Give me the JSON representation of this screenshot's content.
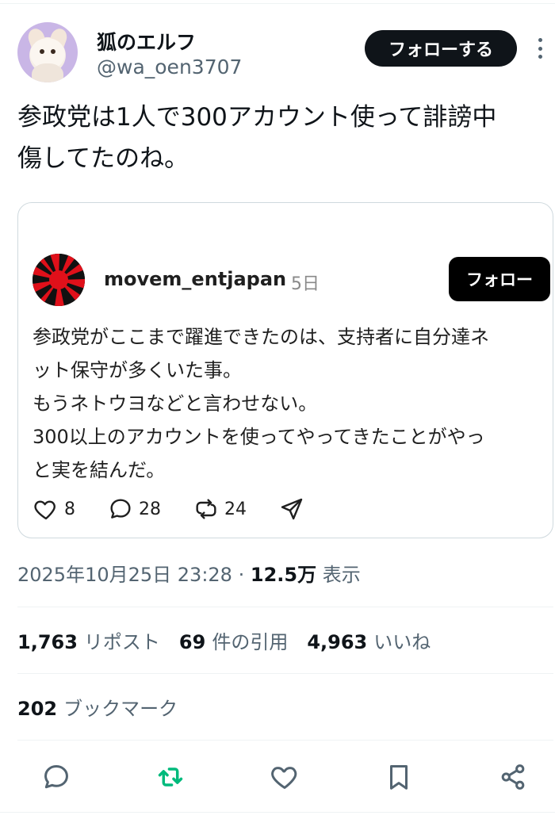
{
  "author": {
    "display_name": "狐のエルフ",
    "handle": "@wa_oen3707",
    "follow_label": "フォローする"
  },
  "tweet": {
    "text_line1": "参政党は1人で300アカウント使って誹謗中",
    "text_line2": "傷してたのね。"
  },
  "quoted_post": {
    "username": "movem_entjapan",
    "time": "5日",
    "follow_label": "フォロー",
    "lines": [
      "参政党がここまで躍進できたのは、支持者に自分達ネ",
      "ット保守が多くいた事。",
      "もうネトウヨなどと言わせない。",
      "300以上のアカウントを使ってやってきたことがやっ",
      "と実を結んだ。"
    ],
    "likes": "8",
    "replies": "28",
    "reposts": "24"
  },
  "meta": {
    "timestamp": "2025年10月25日 23:28",
    "separator": "·",
    "views": "12.5万",
    "views_label": "表示"
  },
  "stats": {
    "reposts_count": "1,763",
    "reposts_label": "リポスト",
    "quotes_count": "69",
    "quotes_label": "件の引用",
    "likes_count": "4,963",
    "likes_label": "いいね",
    "bookmarks_count": "202",
    "bookmarks_label": "ブックマーク"
  },
  "colors": {
    "primary_text": "#0f1419",
    "secondary_text": "#536471",
    "repost_green": "#00ba7c",
    "border": "#cfd9de"
  },
  "icons": {
    "reply": "reply-icon",
    "repost": "repost-icon",
    "like": "like-icon",
    "bookmark": "bookmark-icon",
    "share": "share-icon",
    "more": "more-options-icon"
  }
}
